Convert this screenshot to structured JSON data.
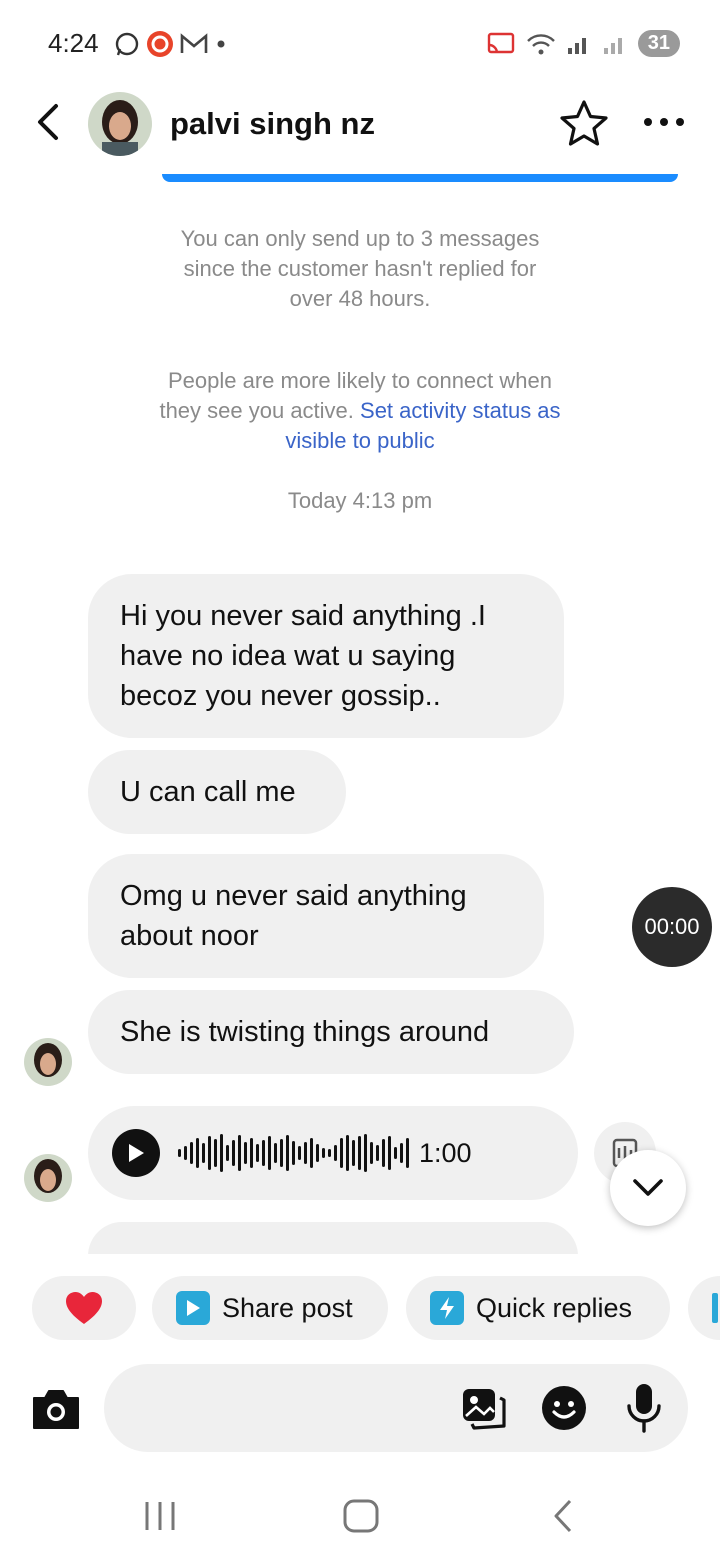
{
  "status_bar": {
    "time": "4:24",
    "battery": "31",
    "left_icons": [
      "whatsapp-icon",
      "app-icon",
      "gmail-icon",
      "dot-icon"
    ],
    "right_icons": [
      "cast-icon",
      "wifi-icon",
      "signal-icon",
      "signal-icon-2"
    ]
  },
  "header": {
    "name": "palvi singh nz"
  },
  "notices": {
    "limit_line1": "You can only send up to 3 messages",
    "limit_line2": "since the customer hasn't replied for",
    "limit_line3": "over 48 hours.",
    "activity_line1": "People are more likely to connect when",
    "activity_line2_text": "they see you active. ",
    "activity_line2_link": "Set activity status as",
    "activity_line3_link": "visible to public"
  },
  "timestamp": "Today 4:13 pm",
  "messages": [
    {
      "line1": "Hi you never said anything .I",
      "line2": "have no idea wat u saying",
      "line3": "becoz you never gossip.."
    },
    {
      "line1": "U can call me"
    },
    {
      "line1": "Omg u never said anything",
      "line2": "about noor"
    },
    {
      "line1": "She is twisting things around"
    }
  ],
  "voice_message": {
    "duration": "1:00",
    "waveform": [
      8,
      14,
      22,
      30,
      20,
      34,
      28,
      38,
      16,
      26,
      36,
      22,
      30,
      18,
      26,
      34,
      20,
      28,
      36,
      24,
      14,
      22,
      30,
      18,
      10,
      8,
      16,
      30,
      36,
      26,
      34,
      38,
      22,
      16,
      28,
      34,
      12,
      20,
      30
    ]
  },
  "recording_timer": "00:00",
  "quick_actions": {
    "share_post": "Share post",
    "quick_replies": "Quick replies"
  },
  "colors": {
    "accent_blue": "#1a8cff",
    "link": "#3a64c8",
    "bubble": "#f0f0f0",
    "heart": "#e8263a",
    "chip_icon": "#2aa8d8"
  }
}
